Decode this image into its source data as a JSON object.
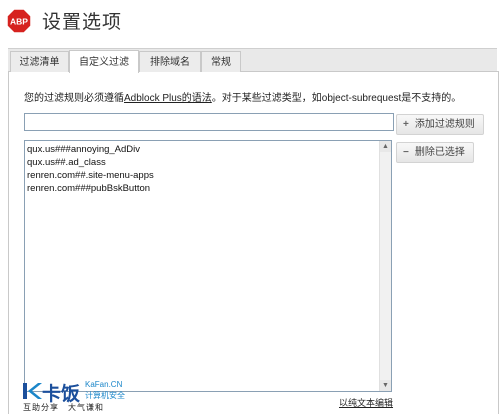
{
  "header": {
    "logo_text": "ABP",
    "title": "设置选项"
  },
  "tabs": [
    {
      "label": "过滤清单"
    },
    {
      "label": "自定义过滤"
    },
    {
      "label": "排除域名"
    },
    {
      "label": "常规"
    }
  ],
  "active_tab": "自定义过滤",
  "help": {
    "prefix": "您的过滤规则必须遵循",
    "link": "Adblock Plus的语法",
    "suffix": "。对于某些过滤类型，如object-subrequest是不支持的。"
  },
  "filter_input": {
    "value": "",
    "placeholder": ""
  },
  "buttons": {
    "add_icon": "+",
    "add": "添加过滤规则",
    "remove_icon": "−",
    "remove": "删除已选择"
  },
  "rules": [
    "qux.us###annoying_AdDiv",
    "qux.us##.ad_class",
    "renren.com##.site-menu-apps",
    "renren.com###pubBskButton"
  ],
  "plain_edit_link": "以纯文本编辑",
  "watermark": {
    "brand": "卡饭",
    "domain": "KaFan.CN",
    "tag": "计算机安全",
    "slogan": "互助分享　大气谦和"
  },
  "colors": {
    "logo_red": "#d6221f",
    "brand_blue": "#1b4f9c",
    "input_border": "#8aa0b4"
  }
}
